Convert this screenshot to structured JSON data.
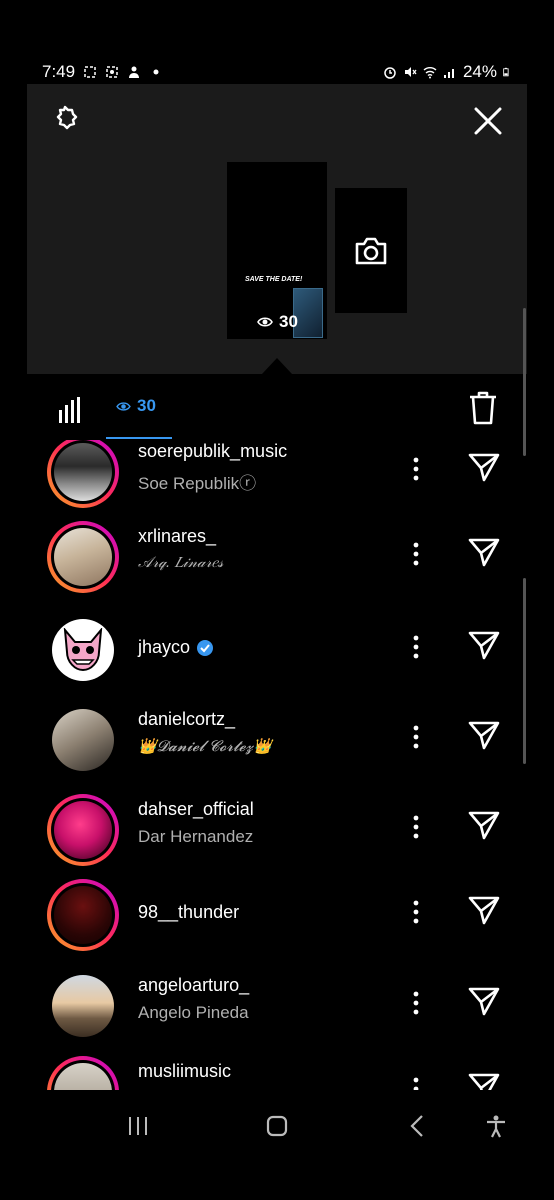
{
  "status_bar": {
    "time": "7:49",
    "battery": "24%"
  },
  "story_preview": {
    "thumb_caption": "SAVE THE DATE!",
    "views": "30"
  },
  "stats": {
    "view_count": "30"
  },
  "viewers": [
    {
      "username": "soerepublik_music",
      "full_name": "Soe Republikⓡ",
      "verified": false
    },
    {
      "username": "xrlinares_",
      "full_name": "𝒜𝓇𝓆. 𝐿𝒾𝓃𝒶𝓇𝑒𝓈",
      "verified": false
    },
    {
      "username": "jhayco",
      "full_name": "",
      "verified": true
    },
    {
      "username": "danielcortz_",
      "full_name": "👑𝓓𝓪𝓷𝓲𝓮𝓵 𝓒𝓸𝓻𝓽𝓮𝔃👑",
      "verified": false
    },
    {
      "username": "dahser_official",
      "full_name": "Dar Hernandez",
      "verified": false
    },
    {
      "username": "98__thunder",
      "full_name": "",
      "verified": false
    },
    {
      "username": "angeloarturo_",
      "full_name": "Angelo Pineda",
      "verified": false
    },
    {
      "username": "musliimusic",
      "full_name": "",
      "verified": false
    }
  ],
  "colors": {
    "accent": "#3897f0",
    "panel": "#1b1b1b",
    "ring_start": "#f9a825",
    "ring_mid": "#ff2d55",
    "ring_end": "#c300d6"
  },
  "icons": [
    "settings-icon",
    "close-icon",
    "camera-icon",
    "eye-icon",
    "bar-chart-icon",
    "trash-icon",
    "more-icon",
    "send-icon",
    "recents-icon",
    "home-icon",
    "back-icon",
    "accessibility-icon"
  ]
}
